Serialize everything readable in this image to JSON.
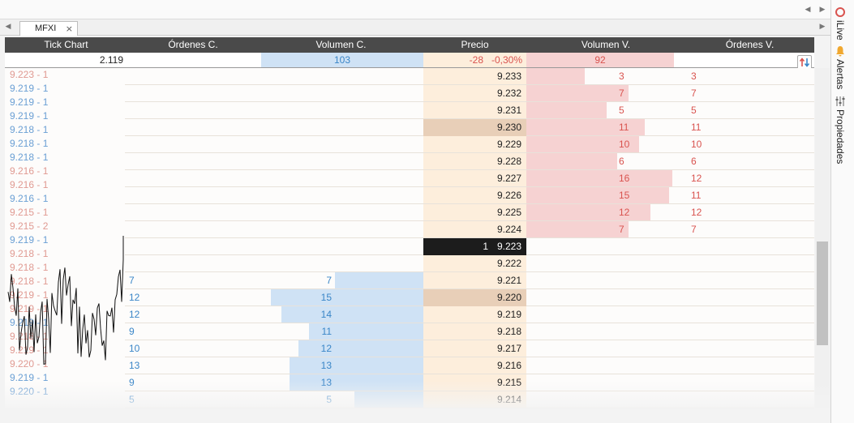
{
  "tabs": [
    {
      "label": "MFXI",
      "close": "×"
    }
  ],
  "nav": {
    "scroll_left": "◀",
    "scroll_right": "▶",
    "tab_left": "◀",
    "tab_right": "▶"
  },
  "columns": {
    "tick_chart": "Tick Chart",
    "buy_orders": "Órdenes C.",
    "buy_volume": "Volumen C.",
    "price": "Precio",
    "sell_volume": "Volumen V.",
    "sell_orders": "Órdenes V."
  },
  "summary": {
    "tick_value": "2.119",
    "buy_volume": "103",
    "change": "-28",
    "change_pct": "-0,30%",
    "sell_volume": "92"
  },
  "sidebar": {
    "live": "iLive",
    "alerts": "Alertas",
    "properties": "Propiedades"
  },
  "ticks": [
    {
      "text": "9.223 - 1",
      "side": "sell"
    },
    {
      "text": "9.219 - 1",
      "side": "buy"
    },
    {
      "text": "9.219 - 1",
      "side": "buy"
    },
    {
      "text": "9.219 - 1",
      "side": "buy"
    },
    {
      "text": "9.218 - 1",
      "side": "buy"
    },
    {
      "text": "9.218 - 1",
      "side": "buy"
    },
    {
      "text": "9.218 - 1",
      "side": "buy"
    },
    {
      "text": "9.216 - 1",
      "side": "sell"
    },
    {
      "text": "9.216 - 1",
      "side": "sell"
    },
    {
      "text": "9.216 - 1",
      "side": "buy"
    },
    {
      "text": "9.215 - 1",
      "side": "sell"
    },
    {
      "text": "9.215 - 2",
      "side": "sell"
    },
    {
      "text": "9.219 - 1",
      "side": "buy"
    },
    {
      "text": "9.218 - 1",
      "side": "sell"
    },
    {
      "text": "9.218 - 1",
      "side": "sell"
    },
    {
      "text": "9.218 - 1",
      "side": "sell"
    },
    {
      "text": "9.219 - 1",
      "side": "sell"
    },
    {
      "text": "9.219 - 1",
      "side": "sell"
    },
    {
      "text": "9.219 - 1",
      "side": "buy"
    },
    {
      "text": "9.218 - 1",
      "side": "sell"
    },
    {
      "text": "9.219 - 1",
      "side": "sell"
    },
    {
      "text": "9.220 - 1",
      "side": "sell"
    },
    {
      "text": "9.219 - 1",
      "side": "buy"
    },
    {
      "text": "9.220 - 1",
      "side": "buy"
    }
  ],
  "rows": [
    {
      "price": "9.233",
      "sell_vol": "3",
      "sell_ord": "3",
      "sell_frac": 0.4
    },
    {
      "price": "9.232",
      "sell_vol": "7",
      "sell_ord": "7",
      "sell_frac": 0.7
    },
    {
      "price": "9.231",
      "sell_vol": "5",
      "sell_ord": "5",
      "sell_frac": 0.55
    },
    {
      "price": "9.230",
      "sell_vol": "11",
      "sell_ord": "11",
      "sell_frac": 0.81,
      "highlight": true
    },
    {
      "price": "9.229",
      "sell_vol": "10",
      "sell_ord": "10",
      "sell_frac": 0.77
    },
    {
      "price": "9.228",
      "sell_vol": "6",
      "sell_ord": "6",
      "sell_frac": 0.62
    },
    {
      "price": "9.227",
      "sell_vol": "16",
      "sell_ord": "12",
      "sell_frac": 1.0
    },
    {
      "price": "9.226",
      "sell_vol": "15",
      "sell_ord": "11",
      "sell_frac": 0.98
    },
    {
      "price": "9.225",
      "sell_vol": "12",
      "sell_ord": "12",
      "sell_frac": 0.85
    },
    {
      "price": "9.224",
      "sell_vol": "7",
      "sell_ord": "7",
      "sell_frac": 0.7
    },
    {
      "price": "9.223",
      "last_qty": "1",
      "last": true
    },
    {
      "price": "9.222"
    },
    {
      "price": "9.221",
      "buy_vol": "7",
      "buy_ord": "7",
      "buy_frac": 0.58
    },
    {
      "price": "9.220",
      "buy_vol": "15",
      "buy_ord": "12",
      "buy_frac": 1.0,
      "highlight": true
    },
    {
      "price": "9.219",
      "buy_vol": "14",
      "buy_ord": "12",
      "buy_frac": 0.93
    },
    {
      "price": "9.218",
      "buy_vol": "11",
      "buy_ord": "9",
      "buy_frac": 0.75
    },
    {
      "price": "9.217",
      "buy_vol": "12",
      "buy_ord": "10",
      "buy_frac": 0.82
    },
    {
      "price": "9.216",
      "buy_vol": "13",
      "buy_ord": "13",
      "buy_frac": 0.88
    },
    {
      "price": "9.215",
      "buy_vol": "13",
      "buy_ord": "9",
      "buy_frac": 0.88
    },
    {
      "price": "9.214",
      "buy_vol": "5",
      "buy_ord": "5",
      "buy_frac": 0.45
    }
  ],
  "colors": {
    "buy": "#3a86c8",
    "sell": "#d9534f",
    "buy_bar": "#cfe2f5",
    "sell_bar": "#f6d2d2",
    "price_bg": "#fdeedc",
    "highlight": "#e8cfb8",
    "last_bg": "#1c1c1c"
  }
}
